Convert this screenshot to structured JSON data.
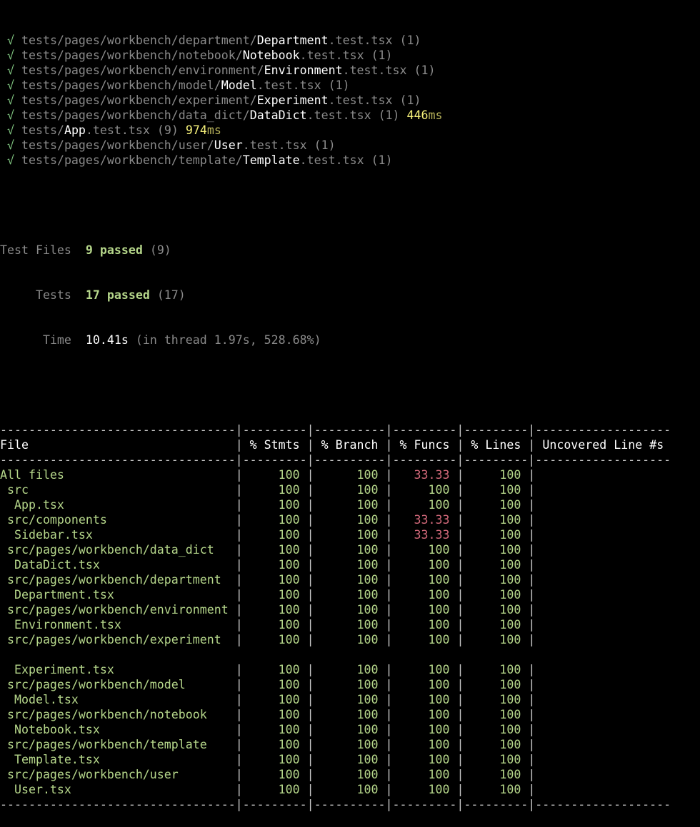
{
  "test_results": [
    {
      "check": "√",
      "dir": "tests/pages/workbench/department/",
      "name": "Department",
      "ext": ".test.tsx",
      "count": "(1)",
      "time": "",
      "time_unit": ""
    },
    {
      "check": "√",
      "dir": "tests/pages/workbench/notebook/",
      "name": "Notebook",
      "ext": ".test.tsx",
      "count": "(1)",
      "time": "",
      "time_unit": ""
    },
    {
      "check": "√",
      "dir": "tests/pages/workbench/environment/",
      "name": "Environment",
      "ext": ".test.tsx",
      "count": "(1)",
      "time": "",
      "time_unit": ""
    },
    {
      "check": "√",
      "dir": "tests/pages/workbench/model/",
      "name": "Model",
      "ext": ".test.tsx",
      "count": "(1)",
      "time": "",
      "time_unit": ""
    },
    {
      "check": "√",
      "dir": "tests/pages/workbench/experiment/",
      "name": "Experiment",
      "ext": ".test.tsx",
      "count": "(1)",
      "time": "",
      "time_unit": ""
    },
    {
      "check": "√",
      "dir": "tests/pages/workbench/data_dict/",
      "name": "DataDict",
      "ext": ".test.tsx",
      "count": "(1)",
      "time": "446",
      "time_unit": "ms"
    },
    {
      "check": "√",
      "dir": "tests/",
      "name": "App",
      "ext": ".test.tsx",
      "count": "(9)",
      "time": "974",
      "time_unit": "ms"
    },
    {
      "check": "√",
      "dir": "tests/pages/workbench/user/",
      "name": "User",
      "ext": ".test.tsx",
      "count": "(1)",
      "time": "",
      "time_unit": ""
    },
    {
      "check": "√",
      "dir": "tests/pages/workbench/template/",
      "name": "Template",
      "ext": ".test.tsx",
      "count": "(1)",
      "time": "",
      "time_unit": ""
    }
  ],
  "summary": {
    "test_files_label": "Test Files",
    "test_files_value": "9 passed",
    "test_files_count": "(9)",
    "tests_label": "Tests",
    "tests_value": "17 passed",
    "tests_count": "(17)",
    "time_label": "Time",
    "time_value": "10.41s",
    "time_detail": "(in thread 1.97s, 528.68%)"
  },
  "coverage": {
    "separator": "---------------------------------|---------|----------|---------|---------|-------------------",
    "headers": [
      "File",
      "% Stmts",
      "% Branch",
      "% Funcs",
      "% Lines",
      "Uncovered Line #s"
    ],
    "rows": [
      {
        "file": "All files",
        "stmts": "100",
        "branch": "100",
        "funcs": "33.33",
        "lines": "100",
        "uncovered": "",
        "funcs_low": true,
        "indent": 0
      },
      {
        "file": "src",
        "stmts": "100",
        "branch": "100",
        "funcs": "100",
        "lines": "100",
        "uncovered": "",
        "funcs_low": false,
        "indent": 1
      },
      {
        "file": "App.tsx",
        "stmts": "100",
        "branch": "100",
        "funcs": "100",
        "lines": "100",
        "uncovered": "",
        "funcs_low": false,
        "indent": 2
      },
      {
        "file": "src/components",
        "stmts": "100",
        "branch": "100",
        "funcs": "33.33",
        "lines": "100",
        "uncovered": "",
        "funcs_low": true,
        "indent": 1
      },
      {
        "file": "Sidebar.tsx",
        "stmts": "100",
        "branch": "100",
        "funcs": "33.33",
        "lines": "100",
        "uncovered": "",
        "funcs_low": true,
        "indent": 2
      },
      {
        "file": "src/pages/workbench/data_dict",
        "stmts": "100",
        "branch": "100",
        "funcs": "100",
        "lines": "100",
        "uncovered": "",
        "funcs_low": false,
        "indent": 1
      },
      {
        "file": "DataDict.tsx",
        "stmts": "100",
        "branch": "100",
        "funcs": "100",
        "lines": "100",
        "uncovered": "",
        "funcs_low": false,
        "indent": 2
      },
      {
        "file": "src/pages/workbench/department",
        "stmts": "100",
        "branch": "100",
        "funcs": "100",
        "lines": "100",
        "uncovered": "",
        "funcs_low": false,
        "indent": 1
      },
      {
        "file": "Department.tsx",
        "stmts": "100",
        "branch": "100",
        "funcs": "100",
        "lines": "100",
        "uncovered": "",
        "funcs_low": false,
        "indent": 2
      },
      {
        "file": "src/pages/workbench/environment",
        "stmts": "100",
        "branch": "100",
        "funcs": "100",
        "lines": "100",
        "uncovered": "",
        "funcs_low": false,
        "indent": 1
      },
      {
        "file": "Environment.tsx",
        "stmts": "100",
        "branch": "100",
        "funcs": "100",
        "lines": "100",
        "uncovered": "",
        "funcs_low": false,
        "indent": 2
      },
      {
        "file": "src/pages/workbench/experiment",
        "stmts": "100",
        "branch": "100",
        "funcs": "100",
        "lines": "100",
        "uncovered": "",
        "funcs_low": false,
        "indent": 1
      },
      {
        "blank": true
      },
      {
        "file": "Experiment.tsx",
        "stmts": "100",
        "branch": "100",
        "funcs": "100",
        "lines": "100",
        "uncovered": "",
        "funcs_low": false,
        "indent": 2
      },
      {
        "file": "src/pages/workbench/model",
        "stmts": "100",
        "branch": "100",
        "funcs": "100",
        "lines": "100",
        "uncovered": "",
        "funcs_low": false,
        "indent": 1
      },
      {
        "file": "Model.tsx",
        "stmts": "100",
        "branch": "100",
        "funcs": "100",
        "lines": "100",
        "uncovered": "",
        "funcs_low": false,
        "indent": 2
      },
      {
        "file": "src/pages/workbench/notebook",
        "stmts": "100",
        "branch": "100",
        "funcs": "100",
        "lines": "100",
        "uncovered": "",
        "funcs_low": false,
        "indent": 1
      },
      {
        "file": "Notebook.tsx",
        "stmts": "100",
        "branch": "100",
        "funcs": "100",
        "lines": "100",
        "uncovered": "",
        "funcs_low": false,
        "indent": 2
      },
      {
        "file": "src/pages/workbench/template",
        "stmts": "100",
        "branch": "100",
        "funcs": "100",
        "lines": "100",
        "uncovered": "",
        "funcs_low": false,
        "indent": 1
      },
      {
        "file": "Template.tsx",
        "stmts": "100",
        "branch": "100",
        "funcs": "100",
        "lines": "100",
        "uncovered": "",
        "funcs_low": false,
        "indent": 2
      },
      {
        "file": "src/pages/workbench/user",
        "stmts": "100",
        "branch": "100",
        "funcs": "100",
        "lines": "100",
        "uncovered": "",
        "funcs_low": false,
        "indent": 1
      },
      {
        "file": "User.tsx",
        "stmts": "100",
        "branch": "100",
        "funcs": "100",
        "lines": "100",
        "uncovered": "",
        "funcs_low": false,
        "indent": 2
      }
    ]
  },
  "colors": {
    "background": "#000000",
    "pass_green": "#b5d68a",
    "low_coverage": "#d2697a",
    "duration": "#f5f07a"
  }
}
